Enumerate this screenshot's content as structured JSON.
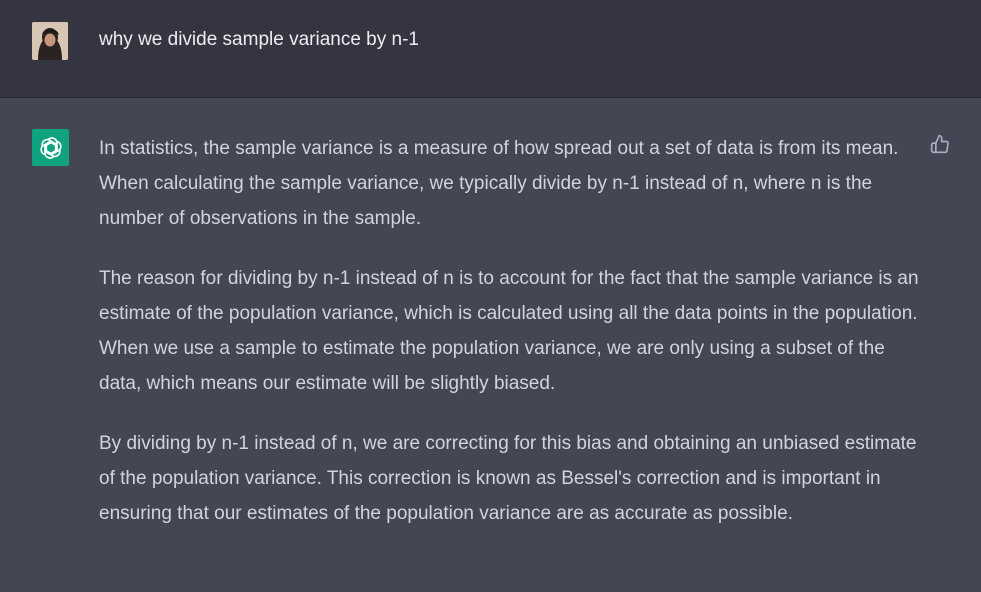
{
  "user_message": {
    "text": "why we divide sample variance by n-1"
  },
  "assistant_message": {
    "paragraphs": [
      "In statistics, the sample variance is a measure of how spread out a set of data is from its mean. When calculating the sample variance, we typically divide by n-1 instead of n, where n is the number of observations in the sample.",
      "The reason for dividing by n-1 instead of n is to account for the fact that the sample variance is an estimate of the population variance, which is calculated using all the data points in the population. When we use a sample to estimate the population variance, we are only using a subset of the data, which means our estimate will be slightly biased.",
      "By dividing by n-1 instead of n, we are correcting for this bias and obtaining an unbiased estimate of the population variance. This correction is known as Bessel's correction and is important in ensuring that our estimates of the population variance are as accurate as possible."
    ]
  },
  "icons": {
    "user_avatar": "user-avatar",
    "assistant_logo": "openai-logo-icon",
    "feedback": "thumbs-up-icon"
  },
  "colors": {
    "user_row_bg": "#343541",
    "assistant_row_bg": "#444654",
    "logo_bg": "#10a37f",
    "text": "#d1d5db"
  }
}
